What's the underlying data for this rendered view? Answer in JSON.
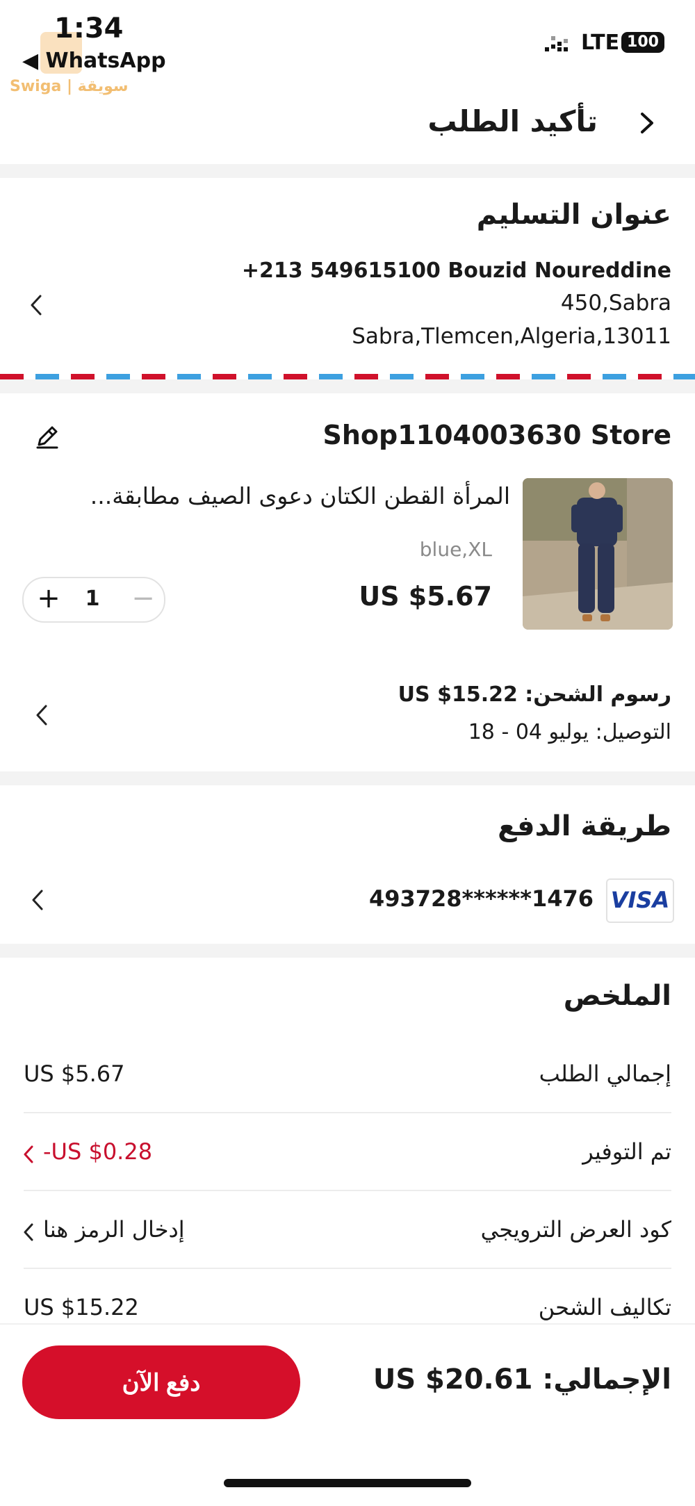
{
  "status_bar": {
    "time": "1:34",
    "back_app": "◀ WhatsApp",
    "watermark": "Swiga | سويقة",
    "network": "LTE",
    "battery": "100"
  },
  "header": {
    "title": "تأكيد الطلب"
  },
  "address": {
    "title": "عنوان التسليم",
    "name_phone": "+213 549615100  Bouzid Noureddine",
    "line1": "450,Sabra",
    "line2": "Sabra,Tlemcen,Algeria,13011"
  },
  "store": {
    "name": "Shop1104003630 Store",
    "product": {
      "title": "المرأة القطن الكتان دعوى الصيف مطابقة...",
      "variant": "blue,XL",
      "price": "US $5.67",
      "quantity": "1"
    },
    "shipping": {
      "fee": "رسوم الشحن: US $15.22",
      "delivery": "التوصيل: يوليو 04 - 18"
    }
  },
  "payment": {
    "title": "طريقة الدفع",
    "card_number": "493728******1476",
    "card_brand": "VISA"
  },
  "summary": {
    "title": "الملخص",
    "rows": [
      {
        "label": "إجمالي الطلب",
        "value": "US $5.67"
      },
      {
        "label": "تم التوفير",
        "value": "-US $0.28"
      },
      {
        "label": "كود العرض الترويجي",
        "value": "إدخال الرمز هنا"
      },
      {
        "label": "تكاليف الشحن",
        "value": "US $15.22"
      }
    ]
  },
  "footer": {
    "total": "الإجمالي: US $20.61",
    "pay_button": "دفع الآن"
  },
  "colors": {
    "accent_red": "#d50f2a",
    "savings_red": "#c8102e",
    "visa_blue": "#1a3ea0"
  }
}
